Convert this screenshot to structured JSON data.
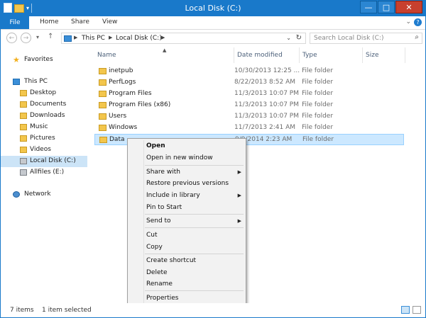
{
  "window": {
    "title": "Local Disk (C:)"
  },
  "titlebar": {
    "minimize": "—",
    "maximize": "□",
    "close": "✕"
  },
  "ribbon": {
    "tabs": [
      "File",
      "Home",
      "Share",
      "View"
    ]
  },
  "address": {
    "crumbs": [
      "This PC",
      "Local Disk (C:)"
    ],
    "search_placeholder": "Search Local Disk (C:)"
  },
  "nav": {
    "items": [
      {
        "label": "Favorites",
        "icon": "star-icon"
      },
      {
        "label": "This PC",
        "icon": "computer-icon"
      },
      {
        "label": "Desktop",
        "icon": "folder-icon"
      },
      {
        "label": "Documents",
        "icon": "folder-icon"
      },
      {
        "label": "Downloads",
        "icon": "folder-icon"
      },
      {
        "label": "Music",
        "icon": "folder-icon"
      },
      {
        "label": "Pictures",
        "icon": "folder-icon"
      },
      {
        "label": "Videos",
        "icon": "folder-icon"
      },
      {
        "label": "Local Disk (C:)",
        "icon": "drive-icon"
      },
      {
        "label": "Allfiles (E:)",
        "icon": "drive-icon"
      },
      {
        "label": "Network",
        "icon": "network-icon"
      }
    ]
  },
  "columns": [
    "Name",
    "Date modified",
    "Type",
    "Size"
  ],
  "files": [
    {
      "name": "inetpub",
      "date": "10/30/2013 12:25 ...",
      "type": "File folder"
    },
    {
      "name": "PerfLogs",
      "date": "8/22/2013 8:52 AM",
      "type": "File folder"
    },
    {
      "name": "Program Files",
      "date": "11/3/2013 10:07 PM",
      "type": "File folder"
    },
    {
      "name": "Program Files (x86)",
      "date": "11/3/2013 10:07 PM",
      "type": "File folder"
    },
    {
      "name": "Users",
      "date": "11/3/2013 10:07 PM",
      "type": "File folder"
    },
    {
      "name": "Windows",
      "date": "11/7/2013 2:41 AM",
      "type": "File folder"
    },
    {
      "name": "Data",
      "date": "9/9/2014 2:23 AM",
      "type": "File folder"
    }
  ],
  "context_menu": {
    "items": [
      {
        "label": "Open"
      },
      {
        "label": "Open in new window"
      },
      {
        "label": "Share with"
      },
      {
        "label": "Restore previous versions"
      },
      {
        "label": "Include in library"
      },
      {
        "label": "Pin to Start"
      },
      {
        "label": "Send to"
      },
      {
        "label": "Cut"
      },
      {
        "label": "Copy"
      },
      {
        "label": "Create shortcut"
      },
      {
        "label": "Delete"
      },
      {
        "label": "Rename"
      },
      {
        "label": "Properties"
      }
    ]
  },
  "status": {
    "item_count": "7 items",
    "selection": "1 item selected"
  },
  "colors": {
    "accent": "#1979ca",
    "selection": "#cce8ff",
    "folder": "#f3c64c"
  }
}
